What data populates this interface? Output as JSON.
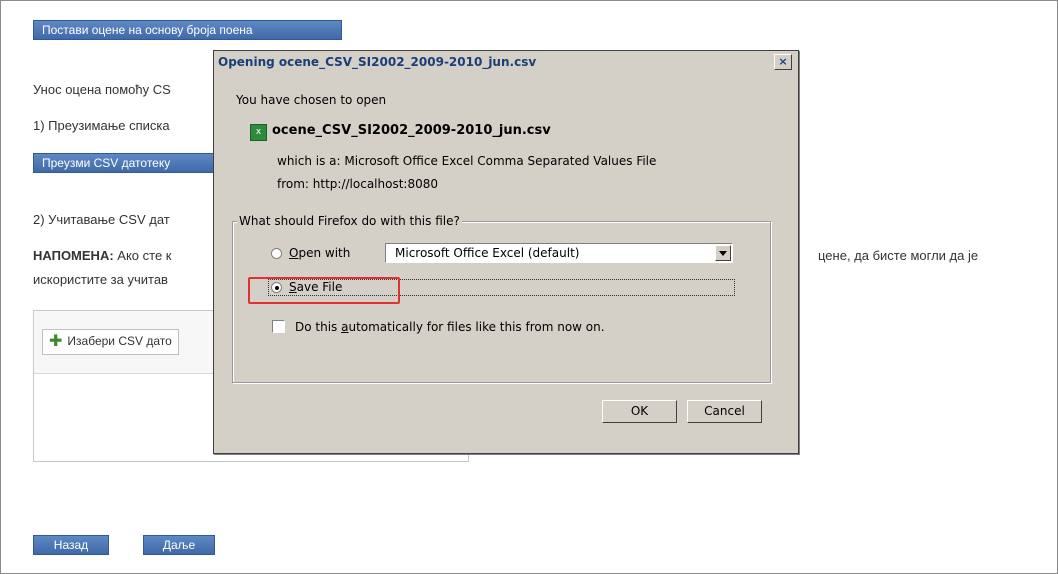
{
  "page": {
    "top_button": "Постави оцене на основу броја поена",
    "line1": "Унос оцена помоћу CS",
    "line2": "1) Преузимање списка",
    "download_button": "Преузми CSV датотеку",
    "line3": "2) Учитавање CSV дат",
    "note_label": "НАПОМЕНА:",
    "note_text": " Ако сте к",
    "note_text_right": "цене, да бисте могли да је",
    "note_line2": "искористите за учитав",
    "choose_button": "Изабери CSV дато",
    "back_button": "Назад",
    "next_button": "Даље"
  },
  "dialog": {
    "title": "Opening ocene_CSV_SI2002_2009-2010_jun.csv",
    "close": "×",
    "intro": "You have chosen to open",
    "filename": "ocene_CSV_SI2002_2009-2010_jun.csv",
    "which_is": "which is a:  Microsoft Office Excel Comma Separated Values File",
    "from": "from:  http://localhost:8080",
    "group_label": "What should Firefox do with this file?",
    "open_with": {
      "pre": "",
      "acc": "O",
      "post": "pen with"
    },
    "open_with_app": "Microsoft Office Excel (default)",
    "save_file": {
      "pre": "",
      "acc": "S",
      "post": "ave File"
    },
    "auto": {
      "pre": "Do this ",
      "acc": "a",
      "post": "utomatically for files like this from now on."
    },
    "ok": "OK",
    "cancel": "Cancel"
  },
  "colors": {
    "page_button": "#4a74b2",
    "dialog_bg": "#d4d0c8",
    "highlight": "#e03030"
  },
  "icons": {
    "file_icon": "excel-file-icon",
    "plus_icon": "plus-icon",
    "close_icon": "close-icon",
    "dropdown_icon": "chevron-down-icon"
  }
}
